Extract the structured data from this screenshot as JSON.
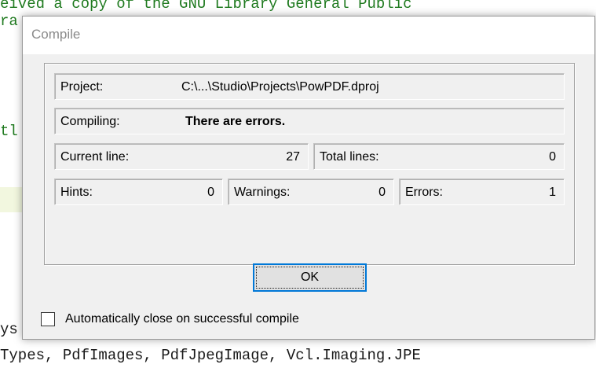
{
  "editor": {
    "lines": [
      "eived a copy of the GNU Library General Public",
      "ra",
      "tl",
      "ys",
      "Types, PdfImages, PdfJpegImage, Vcl.Imaging.JPE"
    ]
  },
  "dialog": {
    "title": "Compile",
    "project_label": "Project:",
    "project_value": "C:\\...\\Studio\\Projects\\PowPDF.dproj",
    "compiling_label": "Compiling:",
    "compiling_value": "There are errors.",
    "current_line_label": "Current line:",
    "current_line_value": "27",
    "total_lines_label": "Total lines:",
    "total_lines_value": "0",
    "hints_label": "Hints:",
    "hints_value": "0",
    "warnings_label": "Warnings:",
    "warnings_value": "0",
    "errors_label": "Errors:",
    "errors_value": "1",
    "ok_label": "OK",
    "auto_close_label": "Automatically close on successful compile",
    "auto_close_checked": false
  },
  "colors": {
    "code_comment": "#1f7a1f",
    "focus_border": "#0078d7"
  }
}
